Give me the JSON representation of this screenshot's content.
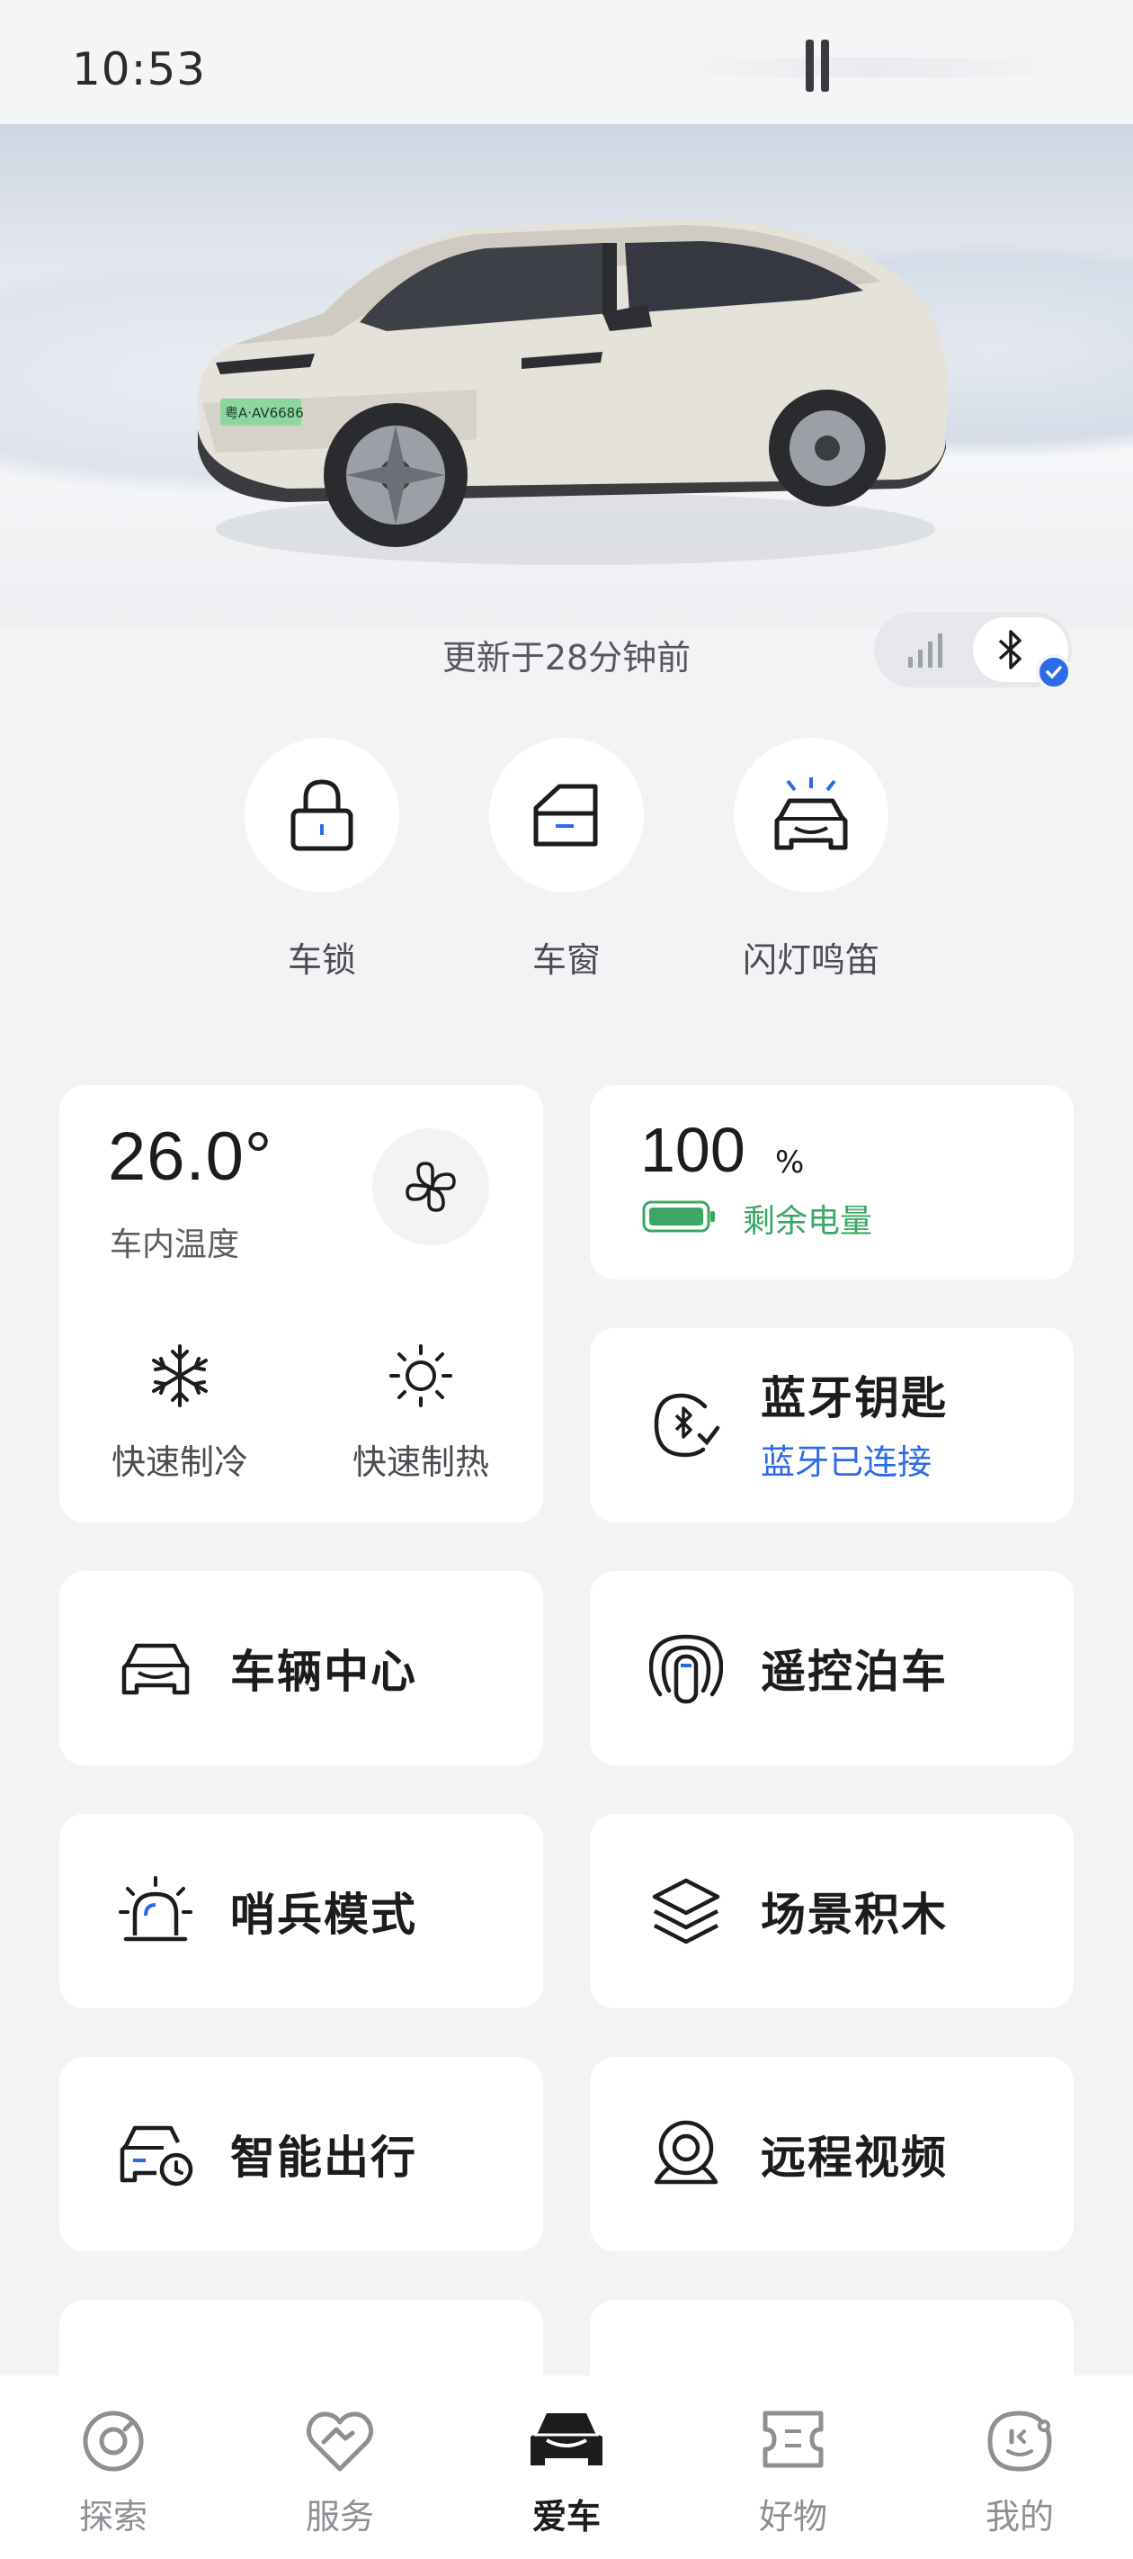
{
  "status_bar": {
    "time": "10:53"
  },
  "vehicle": {
    "plate": "粤A·AV6686",
    "update_text": "更新于28分钟前"
  },
  "quick_actions": [
    {
      "label": "车锁",
      "icon": "lock-icon"
    },
    {
      "label": "车窗",
      "icon": "window-icon"
    },
    {
      "label": "闪灯鸣笛",
      "icon": "flash-horn-icon"
    }
  ],
  "climate": {
    "temperature": "26.0°",
    "temperature_label": "车内温度",
    "cool_label": "快速制冷",
    "heat_label": "快速制热"
  },
  "battery": {
    "value": "100",
    "unit": "%",
    "label": "剩余电量",
    "level_percent": 100
  },
  "bluetooth_key": {
    "title": "蓝牙钥匙",
    "status": "蓝牙已连接"
  },
  "tiles": [
    {
      "label": "车辆中心",
      "icon": "car-icon"
    },
    {
      "label": "遥控泊车",
      "icon": "remote-parking-icon"
    },
    {
      "label": "哨兵模式",
      "icon": "siren-icon"
    },
    {
      "label": "场景积木",
      "icon": "layers-icon"
    },
    {
      "label": "智能出行",
      "icon": "car-clock-icon"
    },
    {
      "label": "远程视频",
      "icon": "camera-icon"
    }
  ],
  "bottom_nav": [
    {
      "label": "探索",
      "icon": "compass-icon",
      "active": false
    },
    {
      "label": "服务",
      "icon": "heart-handshake-icon",
      "active": false
    },
    {
      "label": "爱车",
      "icon": "car-front-icon",
      "active": true
    },
    {
      "label": "好物",
      "icon": "ticket-icon",
      "active": false
    },
    {
      "label": "我的",
      "icon": "profile-face-icon",
      "active": false
    }
  ],
  "colors": {
    "accent_blue": "#2b6be8",
    "battery_green": "#3aa765",
    "background": "#f2f3f5"
  }
}
